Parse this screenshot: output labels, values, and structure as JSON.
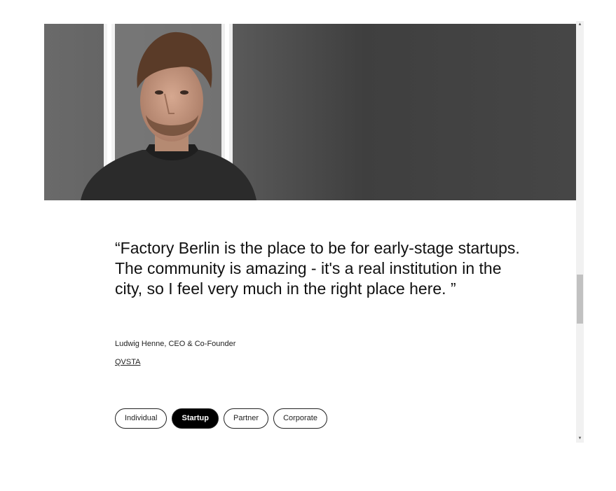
{
  "testimonial": {
    "quote": "“Factory Berlin is the place to be for early-stage startups. The community is amazing - it's a real institution in the city, so I feel very much in the right place here. ”",
    "attribution": "Ludwig Henne, CEO & Co-Founder",
    "company": "QVSTA"
  },
  "filters": {
    "items": [
      "Individual",
      "Startup",
      "Partner",
      "Corporate"
    ],
    "active": "Startup"
  },
  "scrollbar": {
    "up_arrow": "▲",
    "down_arrow": "▼"
  }
}
